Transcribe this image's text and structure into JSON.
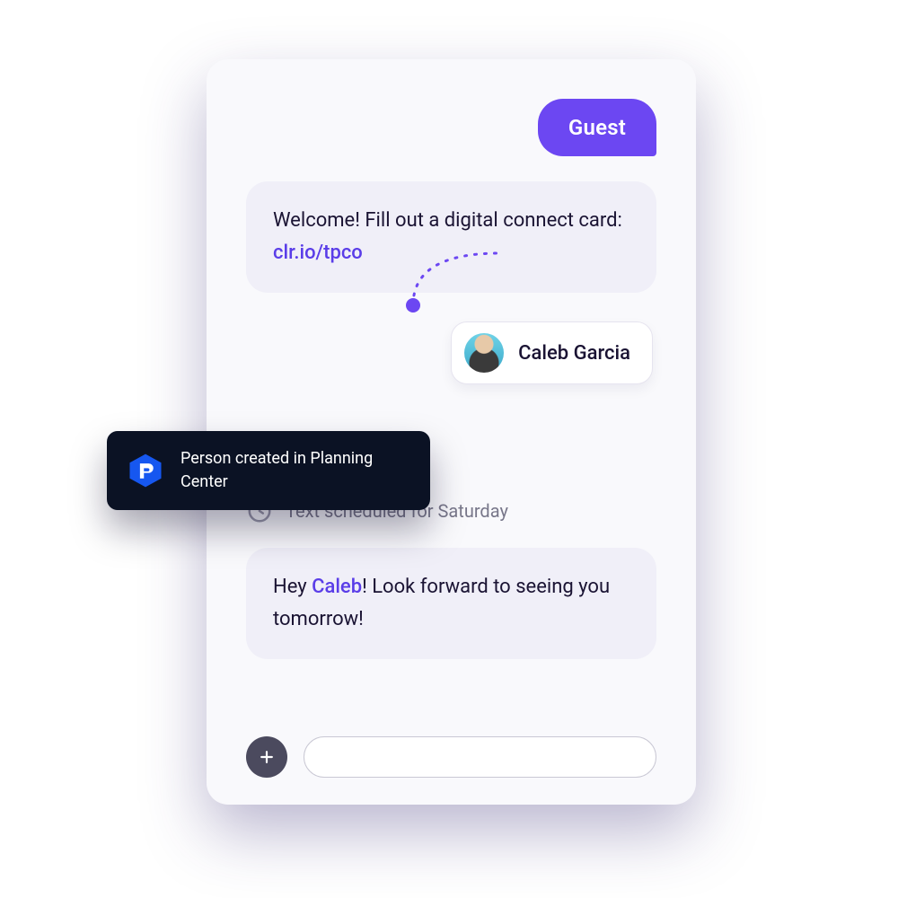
{
  "guest_label": "Guest",
  "welcome": {
    "prefix": "Welcome! Fill out a digital connect card: ",
    "link": "clr.io/tpco"
  },
  "contact": {
    "name": "Caleb Garcia"
  },
  "toast": {
    "text": "Person created in Planning Center"
  },
  "sched": {
    "text": "Text scheduled for Saturday"
  },
  "followup": {
    "pre": "Hey ",
    "mention": "Caleb",
    "post": "! Look forward to seeing you tomorrow!"
  },
  "composer": {
    "placeholder": ""
  },
  "colors": {
    "accent": "#6C47F2",
    "toast_bg": "#0b1224",
    "pc_blue": "#1657F0"
  }
}
